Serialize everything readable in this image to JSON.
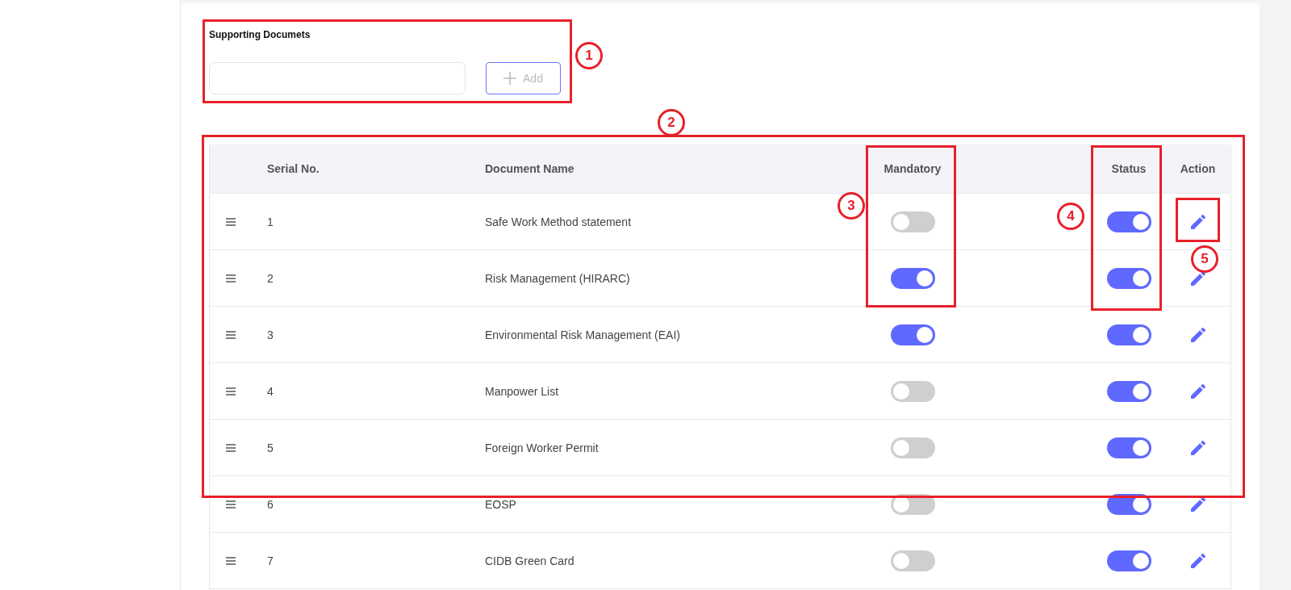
{
  "supporting_documents": {
    "label": "Supporting Documets",
    "add_button": {
      "label": "Add",
      "disabled": true
    }
  },
  "table": {
    "columns": [
      "Serial No.",
      "Document Name",
      "Mandatory",
      "Status",
      "Action"
    ],
    "rows": [
      {
        "serial": "1",
        "name": "Safe Work Method statement",
        "mandatory": false,
        "status": true
      },
      {
        "serial": "2",
        "name": "Risk Management (HIRARC)",
        "mandatory": true,
        "status": true
      },
      {
        "serial": "3",
        "name": "Environmental Risk Management (EAI)",
        "mandatory": true,
        "status": true
      },
      {
        "serial": "4",
        "name": "Manpower List",
        "mandatory": false,
        "status": true
      },
      {
        "serial": "5",
        "name": "Foreign Worker Permit",
        "mandatory": false,
        "status": true
      },
      {
        "serial": "6",
        "name": "EOSP",
        "mandatory": false,
        "status": true
      },
      {
        "serial": "7",
        "name": "CIDB Green Card",
        "mandatory": false,
        "status": true
      }
    ]
  },
  "annotations": [
    {
      "label": "1"
    },
    {
      "label": "2"
    },
    {
      "label": "3"
    },
    {
      "label": "4"
    },
    {
      "label": "5"
    }
  ]
}
